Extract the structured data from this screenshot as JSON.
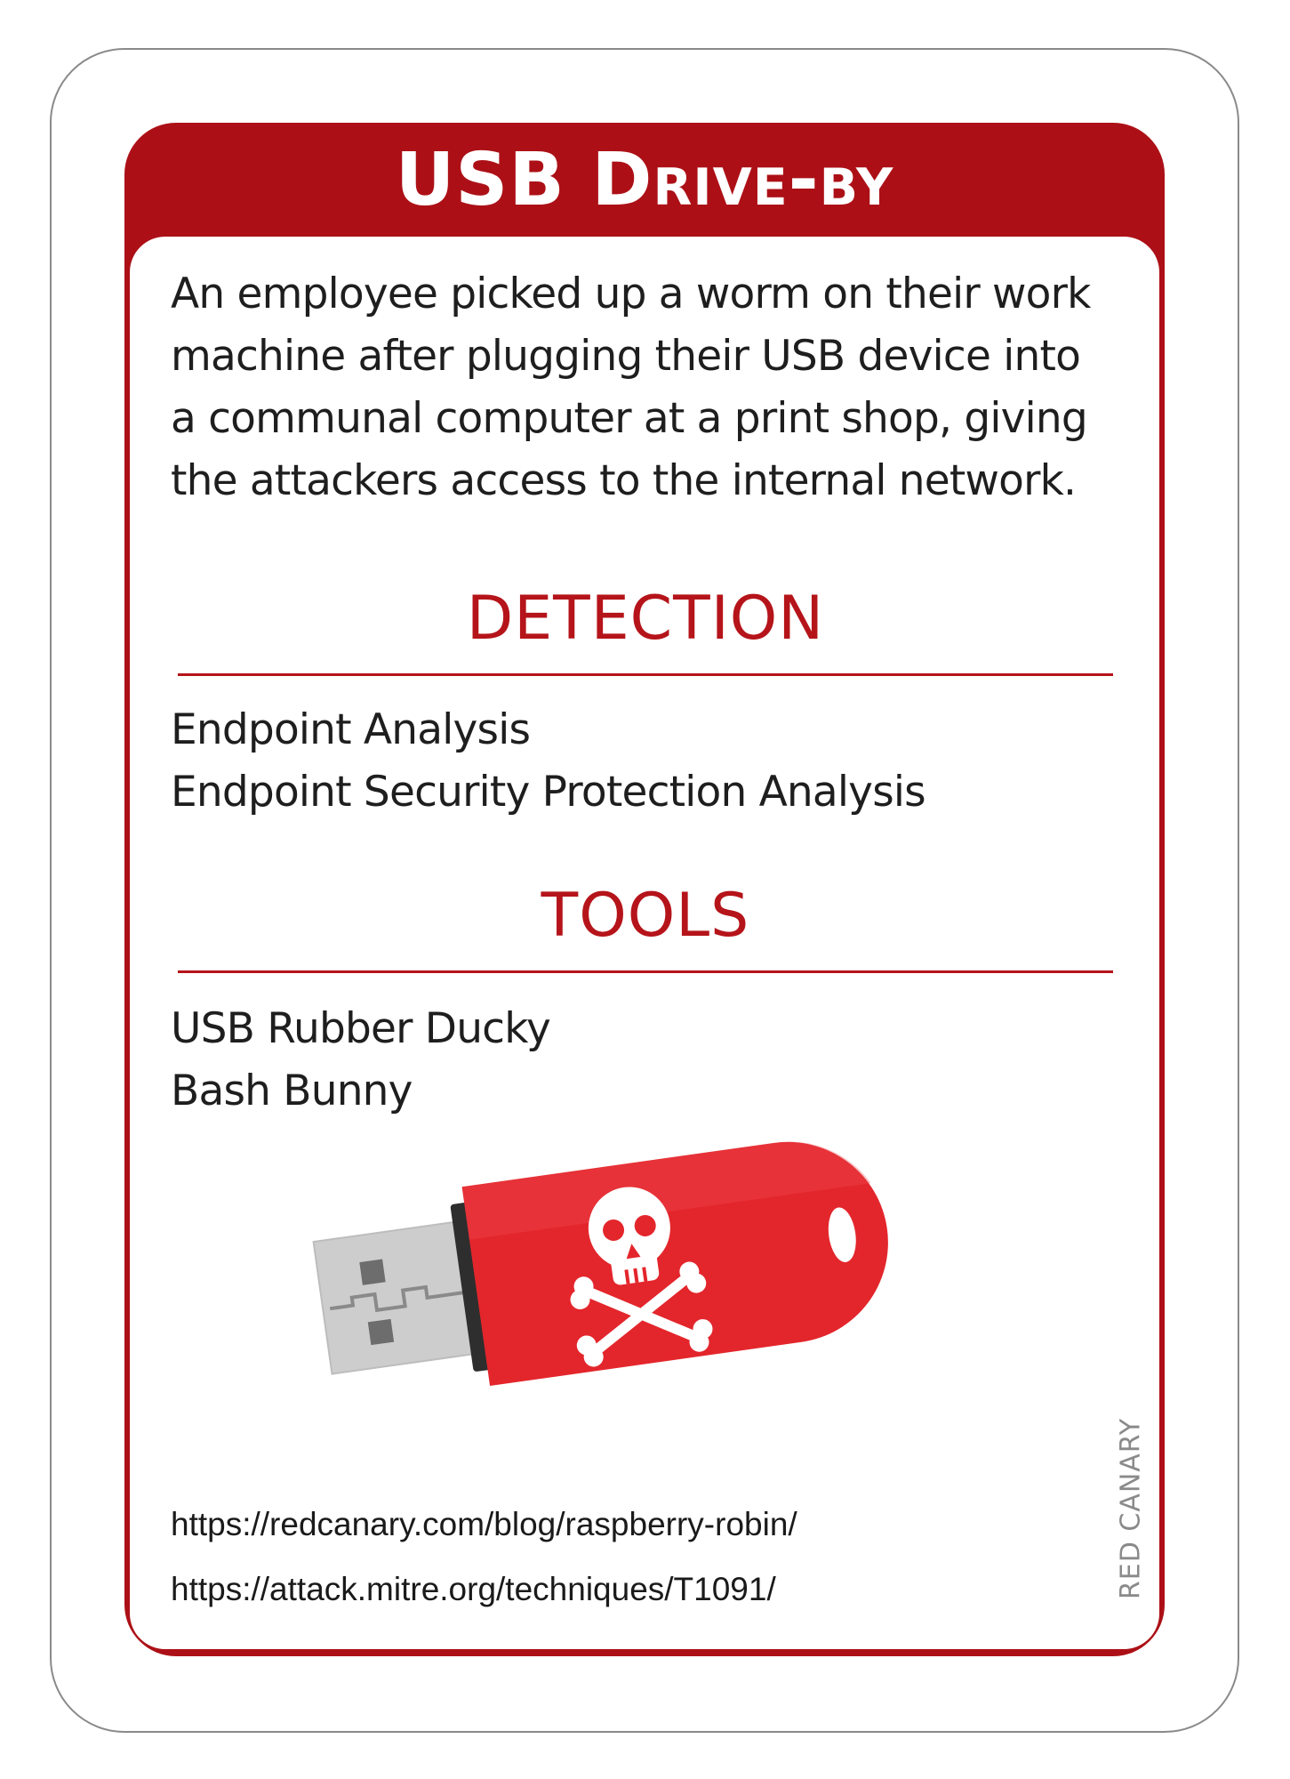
{
  "card": {
    "title_main": "USB",
    "title_rest": "Drive-by",
    "description": "An employee picked up a worm on their work machine after plugging their USB device into a communal computer at a print shop, giving the attackers access to the internal network.",
    "detection": {
      "heading": "DETECTION",
      "items": [
        "Endpoint Analysis",
        "Endpoint Security Protection Analysis"
      ]
    },
    "tools": {
      "heading": "TOOLS",
      "items": [
        "USB Rubber Ducky",
        "Bash Bunny"
      ]
    },
    "illustration": "usb-drive-skull-icon",
    "links": [
      "https://redcanary.com/blog/raspberry-robin/",
      "https://attack.mitre.org/techniques/T1091/"
    ],
    "brand": "RED CANARY",
    "colors": {
      "accent": "#ac1016",
      "heading": "#b5141a",
      "usb_body": "#e3262c",
      "usb_connector": "#c8c8c8"
    }
  }
}
